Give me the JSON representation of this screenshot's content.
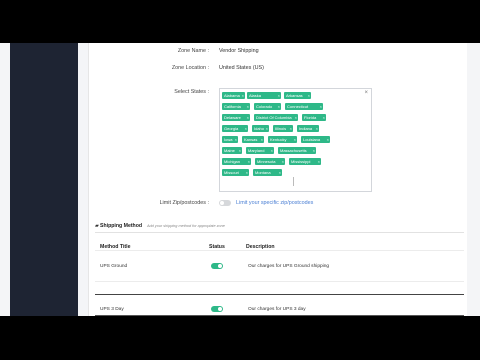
{
  "form": {
    "zone_name_label": "Zone Name :",
    "zone_name_value": "Vendor Shipping",
    "zone_location_label": "Zone Location :",
    "zone_location_value": "United States (US)",
    "select_states_label": "Select States :",
    "states_clear_symbol": "×",
    "states": [
      "Alabama",
      "Alaska",
      "Arkansas",
      "California",
      "Colorado",
      "Connecticut",
      "Delaware",
      "District Of Columbia",
      "Florida",
      "Georgia",
      "Idaho",
      "Illinois",
      "Indiana",
      "Iowa",
      "Kansas",
      "Kentucky",
      "Louisiana",
      "Maine",
      "Maryland",
      "Massachusetts",
      "Michigan",
      "Minnesota",
      "Mississippi",
      "Missouri",
      "Montana"
    ],
    "limit_zip_label": "Limit Zip/postcodes :",
    "limit_zip_link": "Limit your specific zip/postcodes"
  },
  "shipping": {
    "title": "Shipping Method",
    "subtitle": "Add your shipping method for appropiate zone",
    "columns": [
      "Method Title",
      "Status",
      "Description"
    ],
    "rows": [
      {
        "title": "UPS Ground",
        "status": "on",
        "description": "Our charges for UPS Ground shipping"
      },
      {
        "title": "UPS 3 Day",
        "status": "on",
        "description": "Our charges for UPS 3 day"
      }
    ]
  },
  "colors": {
    "accent": "#2eb888",
    "sidebar": "#1e2433",
    "link": "#4a7fd4"
  }
}
